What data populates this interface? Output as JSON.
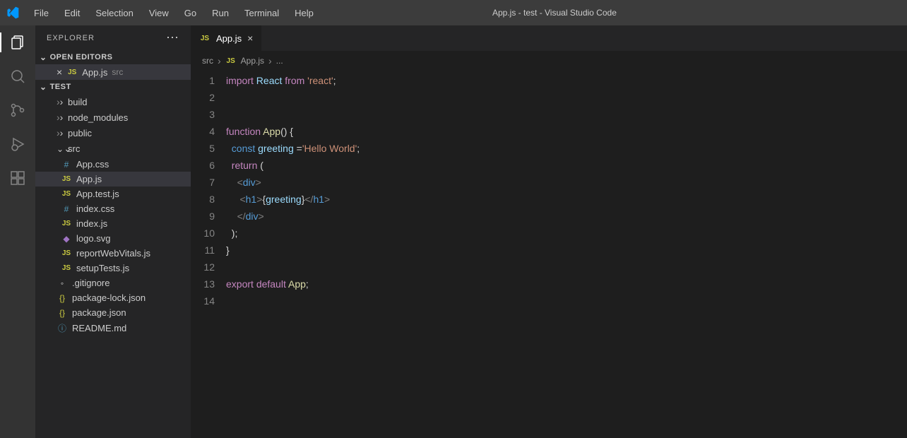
{
  "titlebar": {
    "title": "App.js - test - Visual Studio Code",
    "menu": [
      "File",
      "Edit",
      "Selection",
      "View",
      "Go",
      "Run",
      "Terminal",
      "Help"
    ]
  },
  "sidebar": {
    "title": "EXPLORER",
    "openEditors": {
      "label": "OPEN EDITORS",
      "items": [
        {
          "name": "App.js",
          "hint": "src"
        }
      ]
    },
    "workspace": {
      "label": "TEST",
      "tree": [
        {
          "type": "folder",
          "name": "build",
          "open": false,
          "indent": 1
        },
        {
          "type": "folder",
          "name": "node_modules",
          "open": false,
          "indent": 1
        },
        {
          "type": "folder",
          "name": "public",
          "open": false,
          "indent": 1
        },
        {
          "type": "folder",
          "name": "src",
          "open": true,
          "indent": 1
        },
        {
          "type": "file",
          "name": "App.css",
          "icon": "css",
          "indent": 2
        },
        {
          "type": "file",
          "name": "App.js",
          "icon": "js",
          "indent": 2,
          "active": true
        },
        {
          "type": "file",
          "name": "App.test.js",
          "icon": "js",
          "indent": 2
        },
        {
          "type": "file",
          "name": "index.css",
          "icon": "css",
          "indent": 2
        },
        {
          "type": "file",
          "name": "index.js",
          "icon": "js",
          "indent": 2
        },
        {
          "type": "file",
          "name": "logo.svg",
          "icon": "svg",
          "indent": 2
        },
        {
          "type": "file",
          "name": "reportWebVitals.js",
          "icon": "js",
          "indent": 2
        },
        {
          "type": "file",
          "name": "setupTests.js",
          "icon": "js",
          "indent": 2
        },
        {
          "type": "file",
          "name": ".gitignore",
          "icon": "git",
          "indent": 1
        },
        {
          "type": "file",
          "name": "package-lock.json",
          "icon": "json",
          "indent": 1
        },
        {
          "type": "file",
          "name": "package.json",
          "icon": "json",
          "indent": 1
        },
        {
          "type": "file",
          "name": "README.md",
          "icon": "md",
          "indent": 1
        }
      ]
    }
  },
  "editor": {
    "tab": {
      "label": "App.js"
    },
    "breadcrumb": {
      "folder": "src",
      "file": "App.js",
      "rest": "..."
    },
    "code": {
      "lines": 14,
      "tokens": [
        [
          [
            "kw",
            "import"
          ],
          [
            "plain",
            " "
          ],
          [
            "var",
            "React"
          ],
          [
            "plain",
            " "
          ],
          [
            "kw",
            "from"
          ],
          [
            "plain",
            " "
          ],
          [
            "str",
            "'react'"
          ],
          [
            "plain",
            ";"
          ]
        ],
        [],
        [],
        [
          [
            "kw",
            "function"
          ],
          [
            "plain",
            " "
          ],
          [
            "fn",
            "App"
          ],
          [
            "plain",
            "() {"
          ]
        ],
        [
          [
            "plain",
            "  "
          ],
          [
            "const",
            "const"
          ],
          [
            "plain",
            " "
          ],
          [
            "var",
            "greeting"
          ],
          [
            "plain",
            " ="
          ],
          [
            "str",
            "'Hello World'"
          ],
          [
            "plain",
            ";"
          ]
        ],
        [
          [
            "plain",
            "  "
          ],
          [
            "kw",
            "return"
          ],
          [
            "plain",
            " ("
          ]
        ],
        [
          [
            "plain",
            "    "
          ],
          [
            "tag",
            "<"
          ],
          [
            "tagname",
            "div"
          ],
          [
            "tag",
            ">"
          ]
        ],
        [
          [
            "plain",
            "     "
          ],
          [
            "tag",
            "<"
          ],
          [
            "tagname",
            "h1"
          ],
          [
            "tag",
            ">"
          ],
          [
            "plain",
            "{"
          ],
          [
            "var",
            "greeting"
          ],
          [
            "plain",
            "}"
          ],
          [
            "tag",
            "</"
          ],
          [
            "tagname",
            "h1"
          ],
          [
            "tag",
            ">"
          ]
        ],
        [
          [
            "plain",
            "    "
          ],
          [
            "tag",
            "</"
          ],
          [
            "tagname",
            "div"
          ],
          [
            "tag",
            ">"
          ]
        ],
        [
          [
            "plain",
            "  );"
          ]
        ],
        [
          [
            "plain",
            "}"
          ]
        ],
        [],
        [
          [
            "kw",
            "export"
          ],
          [
            "plain",
            " "
          ],
          [
            "kw",
            "default"
          ],
          [
            "plain",
            " "
          ],
          [
            "fn",
            "App"
          ],
          [
            "plain",
            ";"
          ]
        ],
        []
      ]
    }
  }
}
